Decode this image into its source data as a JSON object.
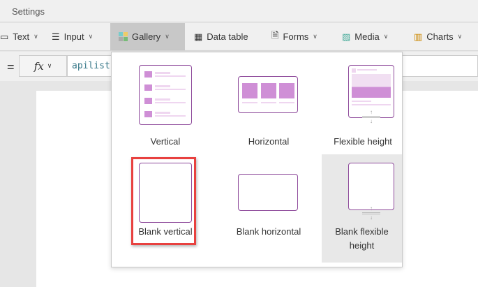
{
  "settings": {
    "title": "Settings"
  },
  "toolbar": {
    "items": [
      {
        "label": "Text",
        "icon": "text-icon"
      },
      {
        "label": "Input",
        "icon": "sliders-icon"
      },
      {
        "label": "Gallery",
        "icon": "gallery-icon",
        "active": true
      },
      {
        "label": "Data table",
        "icon": "table-icon"
      },
      {
        "label": "Forms",
        "icon": "form-icon"
      },
      {
        "label": "Media",
        "icon": "image-icon"
      },
      {
        "label": "Charts",
        "icon": "chart-icon"
      }
    ]
  },
  "formula_bar": {
    "equals": "=",
    "fx": "fx",
    "value": "apilist"
  },
  "gallery_menu": {
    "items": [
      {
        "label": "Vertical"
      },
      {
        "label": "Horizontal"
      },
      {
        "label": "Flexible height"
      },
      {
        "label": "Blank vertical",
        "highlighted": true
      },
      {
        "label": "Blank horizontal"
      },
      {
        "label": "Blank flexible height",
        "hovered": true
      }
    ]
  },
  "colors": {
    "accent": "#8e4a9b",
    "highlight": "#e8413f",
    "selected_bg": "#e8e8e8"
  }
}
